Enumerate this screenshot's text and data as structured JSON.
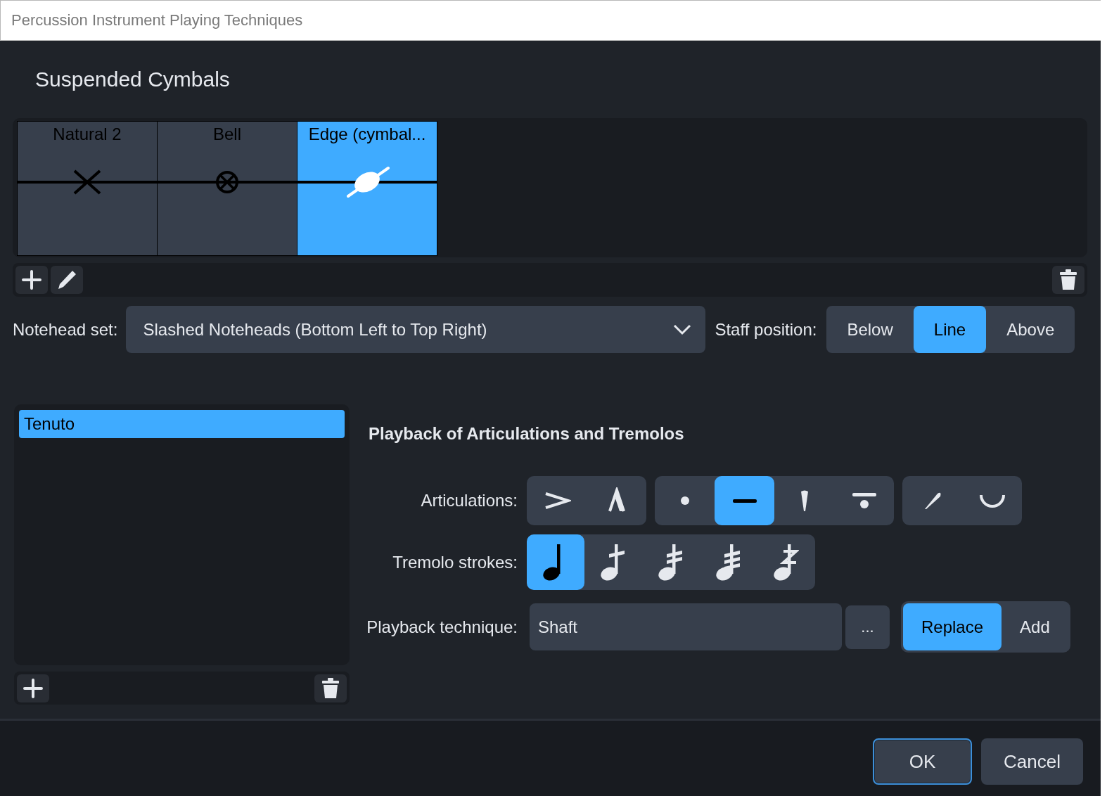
{
  "window": {
    "title": "Percussion Instrument Playing Techniques"
  },
  "instrument_heading": "Suspended Cymbals",
  "techniques": [
    {
      "label": "Natural 2",
      "kind": "x",
      "selected": false
    },
    {
      "label": "Bell",
      "kind": "circle-x",
      "selected": false
    },
    {
      "label": "Edge (cymbal...",
      "kind": "slashed",
      "selected": true
    }
  ],
  "notehead_set": {
    "label": "Notehead set:",
    "value": "Slashed Noteheads (Bottom Left to Top Right)"
  },
  "staff_position": {
    "label": "Staff position:",
    "options": [
      {
        "label": "Below",
        "selected": false
      },
      {
        "label": "Line",
        "selected": true
      },
      {
        "label": "Above",
        "selected": false
      }
    ]
  },
  "articulation_list": [
    {
      "label": "Tenuto",
      "selected": true
    }
  ],
  "playback_heading": "Playback of Articulations and Tremolos",
  "articulations": {
    "label": "Articulations:",
    "groups": [
      [
        {
          "kind": "accent",
          "selected": false
        },
        {
          "kind": "marcato",
          "selected": false
        }
      ],
      [
        {
          "kind": "staccato",
          "selected": false
        },
        {
          "kind": "tenuto",
          "selected": true
        },
        {
          "kind": "staccatissimo",
          "selected": false
        },
        {
          "kind": "tenuto-staccato",
          "selected": false
        }
      ],
      [
        {
          "kind": "stress",
          "selected": false
        },
        {
          "kind": "unstress",
          "selected": false
        }
      ]
    ]
  },
  "tremolo_strokes": {
    "label": "Tremolo strokes:",
    "options": [
      {
        "kind": "none",
        "selected": true
      },
      {
        "kind": "one",
        "selected": false
      },
      {
        "kind": "two",
        "selected": false
      },
      {
        "kind": "three",
        "selected": false
      },
      {
        "kind": "buzz",
        "selected": false
      }
    ]
  },
  "playback_technique": {
    "label": "Playback technique:",
    "value": "Shaft",
    "browse": "...",
    "modes": [
      {
        "label": "Replace",
        "selected": true
      },
      {
        "label": "Add",
        "selected": false
      }
    ]
  },
  "buttons": [
    {
      "label": "OK",
      "default": true
    },
    {
      "label": "Cancel",
      "default": false
    }
  ]
}
